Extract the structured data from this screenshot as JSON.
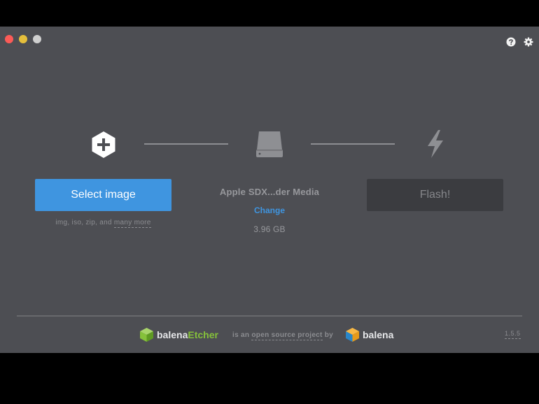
{
  "window": {
    "controls": [
      "close",
      "minimize",
      "maximize"
    ],
    "top_icons": [
      "help-icon",
      "settings-icon"
    ]
  },
  "steps": {
    "image": {
      "icon": "plus-hexagon-icon",
      "button_label": "Select image",
      "formats_prefix": "img, iso, zip, and",
      "formats_link": "many more"
    },
    "drive": {
      "icon": "drive-icon",
      "name": "Apple SDX...der Media",
      "change_label": "Change",
      "size": "3.96 GB"
    },
    "flash": {
      "icon": "lightning-bolt-icon",
      "button_label": "Flash!"
    }
  },
  "footer": {
    "brand_prefix": "balena",
    "brand_accent": "Etcher",
    "byline_prefix": "is an",
    "byline_link": "open source project",
    "byline_suffix": "by",
    "company": "balena",
    "version": "1.5.5"
  },
  "colors": {
    "background": "#4d4e53",
    "accent_blue": "#3f95e0",
    "etcher_green": "#85c13a",
    "flash_disabled": "#3b3c40"
  }
}
